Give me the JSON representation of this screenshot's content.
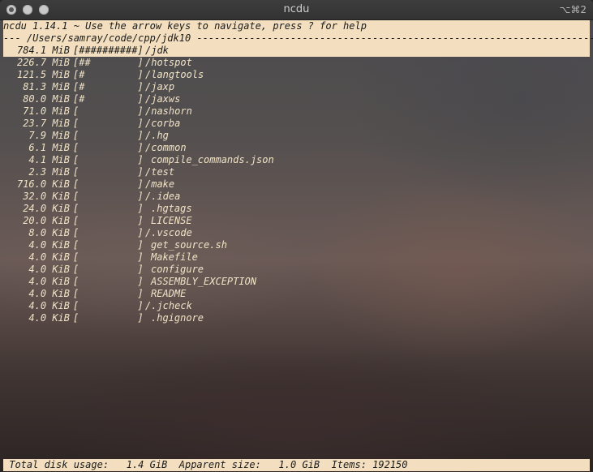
{
  "window": {
    "title": "ncdu",
    "shortcut": "⌥⌘2"
  },
  "header": {
    "help_line": "ncdu 1.14.1 ~ Use the arrow keys to navigate, press ? for help",
    "path_line": "--- /Users/samray/code/cpp/jdk10 ------------------------------------------------------------------------------"
  },
  "rows": [
    {
      "size": "784.1 MiB",
      "graph": "[##########]",
      "name": "/jdk",
      "type": "dir",
      "selected": true,
      "usage_fraction": 1.0
    },
    {
      "size": "226.7 MiB",
      "graph": "[##        ]",
      "name": "/hotspot",
      "type": "dir",
      "usage_fraction": 0.2
    },
    {
      "size": "121.5 MiB",
      "graph": "[#         ]",
      "name": "/langtools",
      "type": "dir",
      "usage_fraction": 0.1
    },
    {
      "size": "81.3 MiB",
      "graph": "[#         ]",
      "name": "/jaxp",
      "type": "dir",
      "usage_fraction": 0.1
    },
    {
      "size": "80.0 MiB",
      "graph": "[#         ]",
      "name": "/jaxws",
      "type": "dir",
      "usage_fraction": 0.1
    },
    {
      "size": "71.0 MiB",
      "graph": "[          ]",
      "name": "/nashorn",
      "type": "dir",
      "usage_fraction": 0.0
    },
    {
      "size": "23.7 MiB",
      "graph": "[          ]",
      "name": "/corba",
      "type": "dir",
      "usage_fraction": 0.0
    },
    {
      "size": "7.9 MiB",
      "graph": "[          ]",
      "name": "/.hg",
      "type": "dir",
      "usage_fraction": 0.0
    },
    {
      "size": "6.1 MiB",
      "graph": "[          ]",
      "name": "/common",
      "type": "dir",
      "usage_fraction": 0.0
    },
    {
      "size": "4.1 MiB",
      "graph": "[          ]",
      "name": "compile_commands.json",
      "type": "file",
      "usage_fraction": 0.0
    },
    {
      "size": "2.3 MiB",
      "graph": "[          ]",
      "name": "/test",
      "type": "dir",
      "usage_fraction": 0.0
    },
    {
      "size": "716.0 KiB",
      "graph": "[          ]",
      "name": "/make",
      "type": "dir",
      "usage_fraction": 0.0
    },
    {
      "size": "32.0 KiB",
      "graph": "[          ]",
      "name": "/.idea",
      "type": "dir",
      "usage_fraction": 0.0
    },
    {
      "size": "24.0 KiB",
      "graph": "[          ]",
      "name": ".hgtags",
      "type": "file",
      "usage_fraction": 0.0
    },
    {
      "size": "20.0 KiB",
      "graph": "[          ]",
      "name": "LICENSE",
      "type": "file",
      "usage_fraction": 0.0
    },
    {
      "size": "8.0 KiB",
      "graph": "[          ]",
      "name": "/.vscode",
      "type": "dir",
      "usage_fraction": 0.0
    },
    {
      "size": "4.0 KiB",
      "graph": "[          ]",
      "name": "get_source.sh",
      "type": "file",
      "usage_fraction": 0.0
    },
    {
      "size": "4.0 KiB",
      "graph": "[          ]",
      "name": "Makefile",
      "type": "file",
      "usage_fraction": 0.0
    },
    {
      "size": "4.0 KiB",
      "graph": "[          ]",
      "name": "configure",
      "type": "file",
      "usage_fraction": 0.0
    },
    {
      "size": "4.0 KiB",
      "graph": "[          ]",
      "name": "ASSEMBLY_EXCEPTION",
      "type": "file",
      "usage_fraction": 0.0
    },
    {
      "size": "4.0 KiB",
      "graph": "[          ]",
      "name": "README",
      "type": "file",
      "usage_fraction": 0.0
    },
    {
      "size": "4.0 KiB",
      "graph": "[          ]",
      "name": "/.jcheck",
      "type": "dir",
      "usage_fraction": 0.0
    },
    {
      "size": "4.0 KiB",
      "graph": "[          ]",
      "name": ".hgignore",
      "type": "file",
      "usage_fraction": 0.0
    }
  ],
  "status": {
    "line": " Total disk usage:   1.4 GiB  Apparent size:   1.0 GiB  Items: 192150"
  },
  "colors": {
    "bar_background": "#f3dfbf",
    "bar_text": "#1a1a1a",
    "list_text": "#f1e3c6",
    "titlebar": "#383838"
  }
}
